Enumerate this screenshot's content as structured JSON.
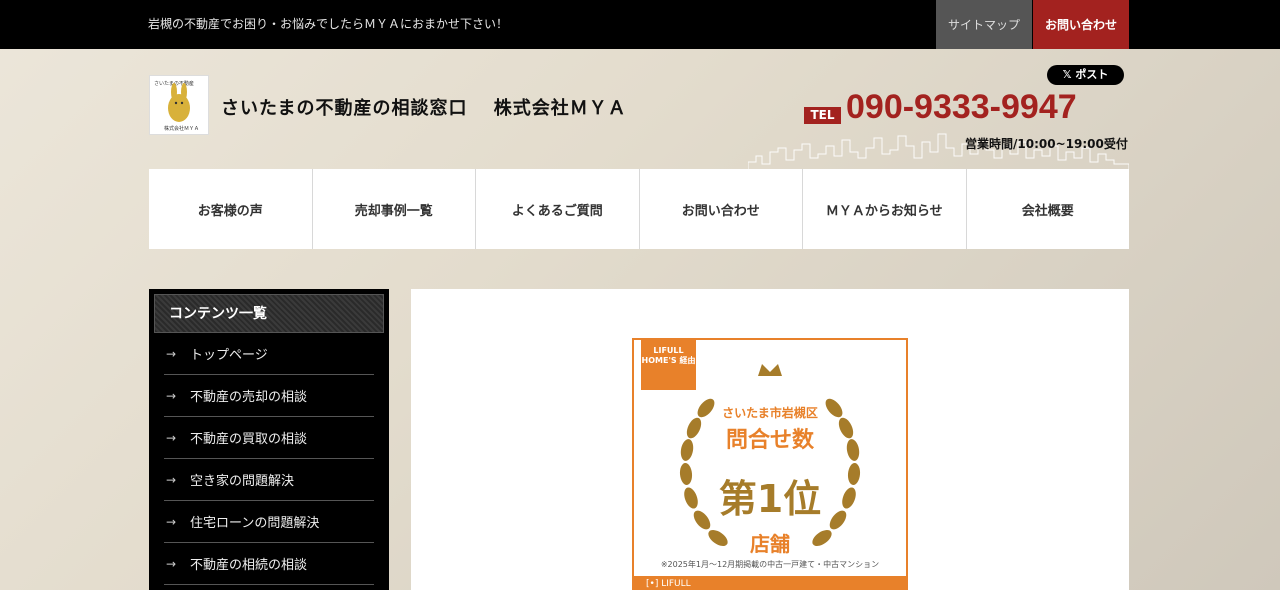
{
  "topbar": {
    "tagline": "岩槻の不動産でお困り・お悩みでしたらＭＹＡにおまかせ下さい！",
    "sitemap": "サイトマップ",
    "contact": "お問い合わせ"
  },
  "header": {
    "logo_text": "さいたまの不動産の相談窓口 株式会社ＭＹＡ",
    "site_title": "さいたまの不動産の相談窓口　 株式会社ＭＹＡ",
    "post_button": "ポスト",
    "tel_label": "TEL",
    "tel_number": "090-9333-9947",
    "hours": "営業時間/10:00~19:00受付"
  },
  "nav": [
    "お客様の声",
    "売却事例一覧",
    "よくあるご質問",
    "お問い合わせ",
    "ＭＹＡからお知らせ",
    "会社概要"
  ],
  "sidebar": {
    "heading": "コンテンツ一覧",
    "items": [
      "トップページ",
      "不動産の売却の相談",
      "不動産の買取の相談",
      "空き家の問題解決",
      "住宅ローンの問題解決",
      "不動産の相続の相談"
    ]
  },
  "award": {
    "tag": "LIFULL HOME'S 経由",
    "area": "さいたま市岩槻区",
    "metric": "問合せ数",
    "rank": "第1位",
    "unit": "店舗",
    "note": "※2025年1月～12月期掲載の中古一戸建て・中古マンション",
    "bottom": "[•] LIFULL"
  },
  "colors": {
    "accent": "#a3221f",
    "award_orange": "#e8812a",
    "gold": "#a67c2a"
  }
}
